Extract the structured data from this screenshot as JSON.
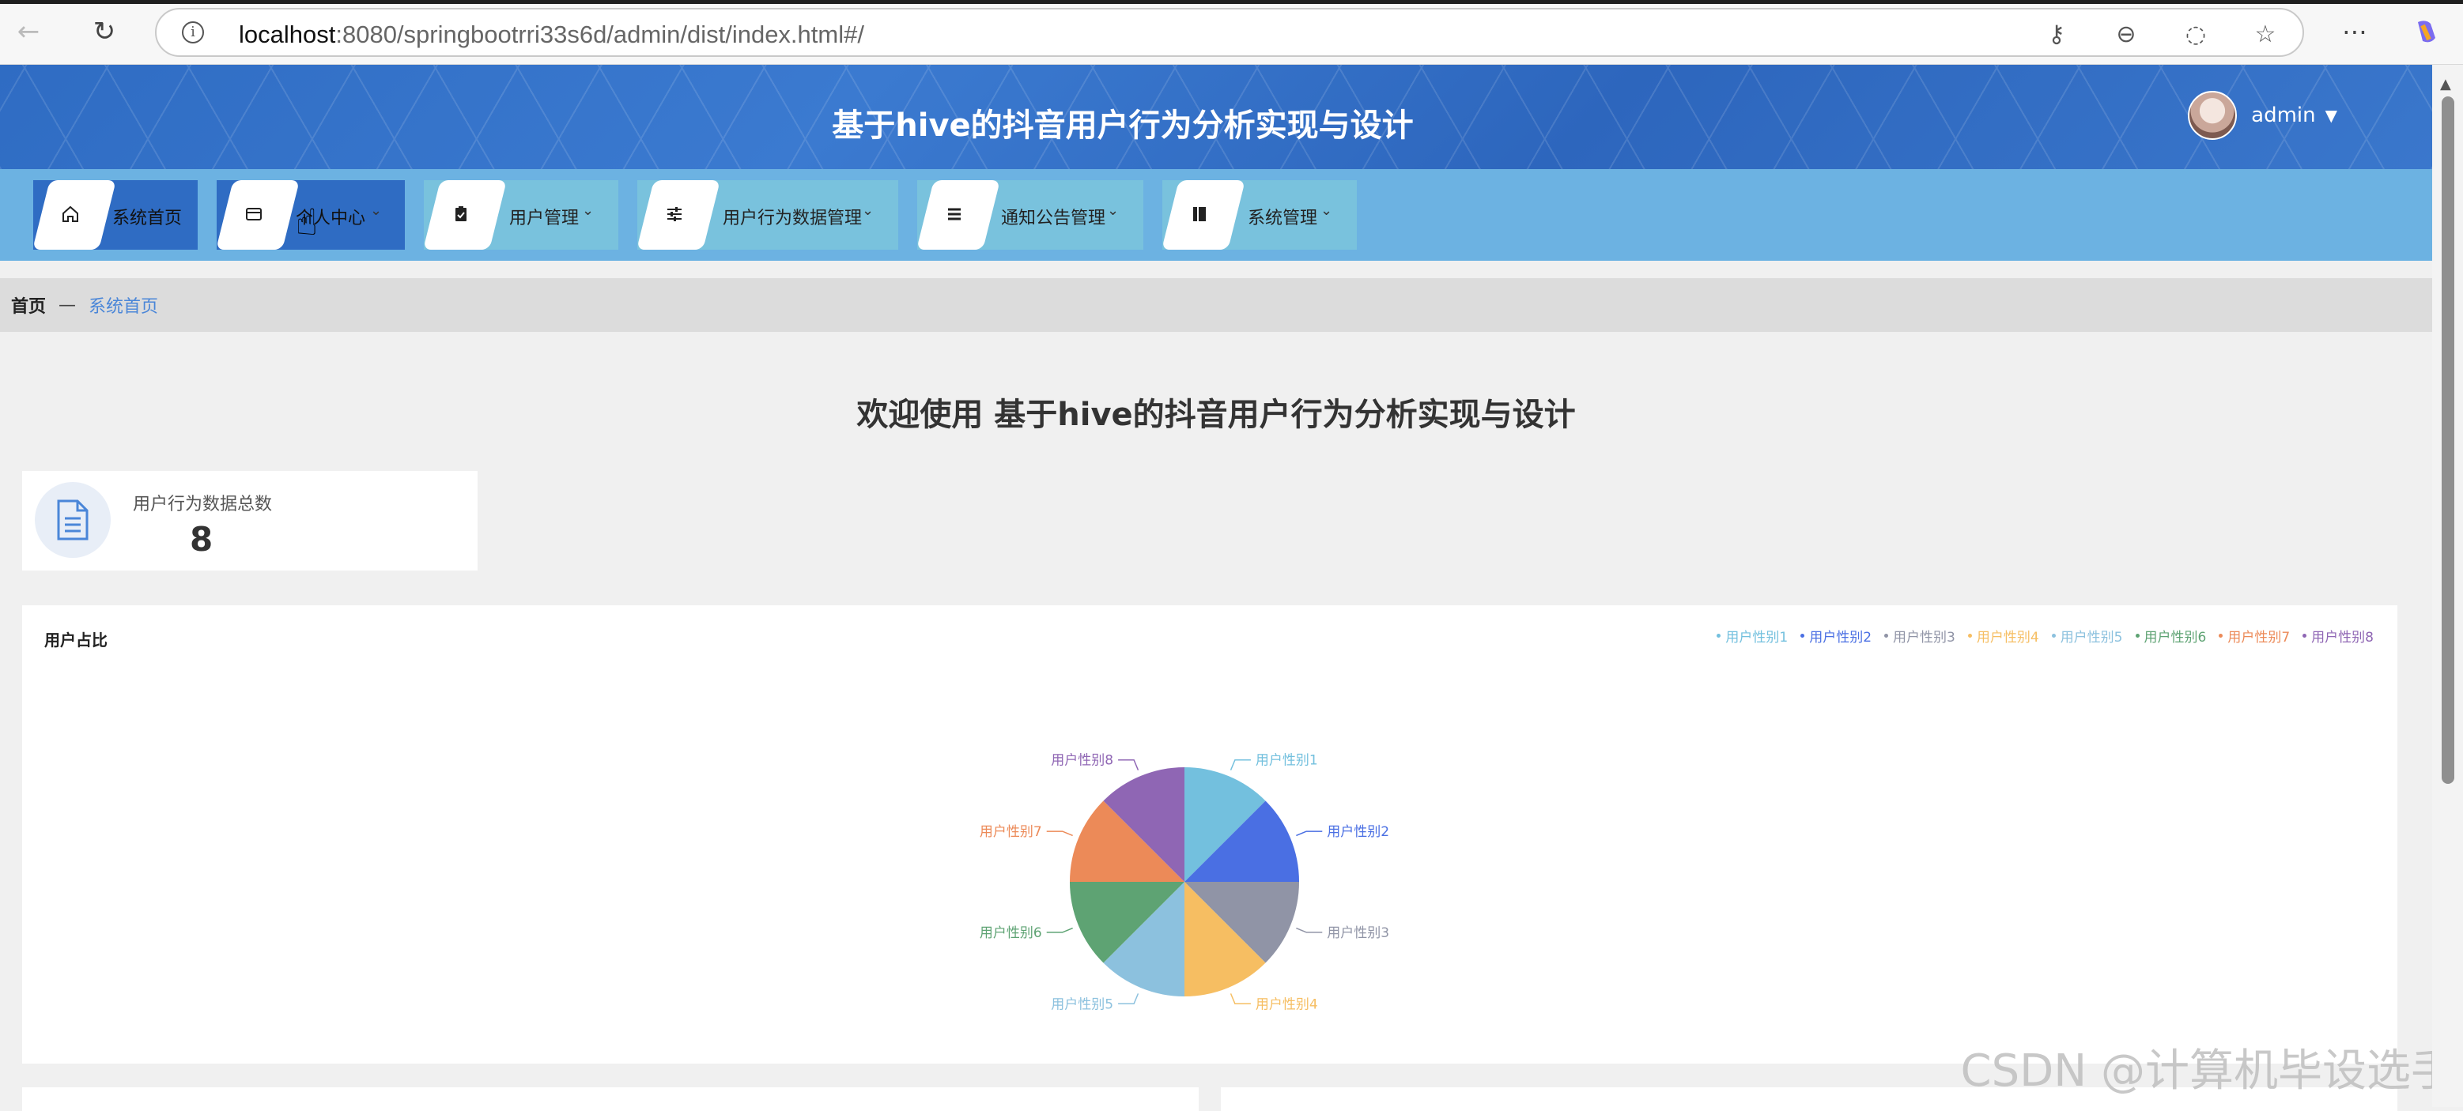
{
  "browser": {
    "url_host": "localhost",
    "url_rest": ":8080/springbootrri33s6d/admin/dist/index.html#/"
  },
  "header": {
    "title": "基于hive的抖音用户行为分析实现与设计",
    "user": "admin"
  },
  "menu": [
    {
      "label": "系统首页",
      "icon": "home-icon",
      "active": true
    },
    {
      "label": "个人中心",
      "icon": "card-icon",
      "active": true
    },
    {
      "label": "用户管理",
      "icon": "clipboard-icon",
      "active": false
    },
    {
      "label": "用户行为数据管理",
      "icon": "sliders-icon",
      "active": false
    },
    {
      "label": "通知公告管理",
      "icon": "list-icon",
      "active": false
    },
    {
      "label": "系统管理",
      "icon": "book-icon",
      "active": false
    }
  ],
  "breadcrumb": {
    "home": "首页",
    "separator": "—",
    "current": "系统首页"
  },
  "welcome": "欢迎使用 基于hive的抖音用户行为分析实现与设计",
  "stat": {
    "label": "用户行为数据总数",
    "value": "8"
  },
  "watermark": "CSDN @计算机毕设选手",
  "chart_data": {
    "type": "pie",
    "title": "用户占比",
    "legend_position": "top-right",
    "categories": [
      "用户性别1",
      "用户性别2",
      "用户性别3",
      "用户性别4",
      "用户性别5",
      "用户性别6",
      "用户性别7",
      "用户性别8"
    ],
    "values": [
      1,
      1,
      1,
      1,
      1,
      1,
      1,
      1
    ],
    "colors": [
      "#73c0de",
      "#4a6fe3",
      "#9094a6",
      "#f6be62",
      "#8cc1de",
      "#5ea373",
      "#ec8a58",
      "#8f66b4"
    ]
  }
}
